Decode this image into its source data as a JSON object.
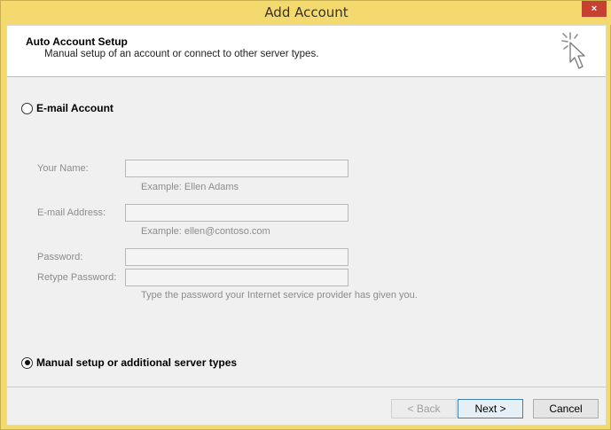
{
  "window": {
    "title": "Add Account",
    "close_icon": "×"
  },
  "header": {
    "title": "Auto Account Setup",
    "subtitle": "Manual setup of an account or connect to other server types."
  },
  "email_account": {
    "label": "E-mail Account",
    "selected": false,
    "fields": {
      "name_label": "Your Name:",
      "name_value": "",
      "name_hint": "Example: Ellen Adams",
      "email_label": "E-mail Address:",
      "email_value": "",
      "email_hint": "Example: ellen@contoso.com",
      "password_label": "Password:",
      "password_value": "",
      "retype_label": "Retype Password:",
      "retype_value": "",
      "password_hint": "Type the password your Internet service provider has given you."
    }
  },
  "manual_setup": {
    "label": "Manual setup or additional server types",
    "selected": true
  },
  "buttons": {
    "back": "< Back",
    "next": "Next >",
    "cancel": "Cancel"
  },
  "colors": {
    "title_bar": "#f3d96e",
    "close_button": "#c74133",
    "dialog_bg": "#f0f0f0",
    "disabled_text": "#8c8c8c"
  }
}
